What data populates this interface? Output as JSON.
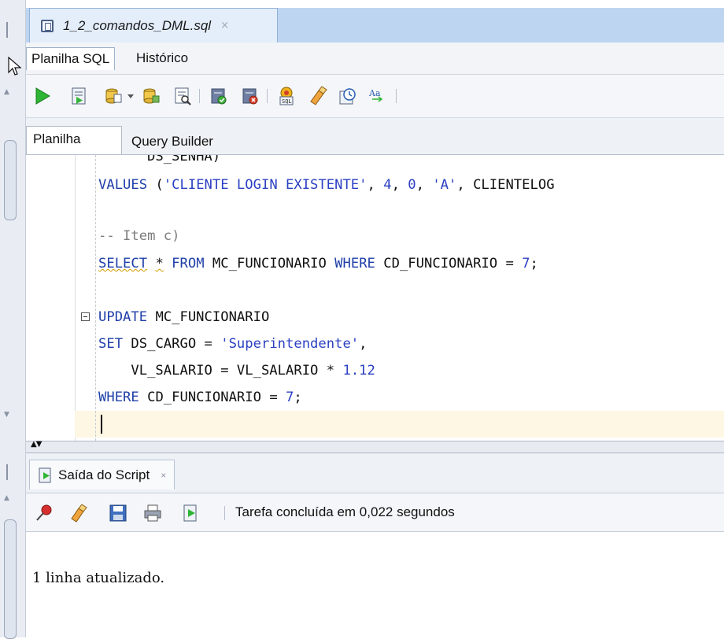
{
  "file_tab": {
    "title": "1_2_comandos_DML.sql",
    "close": "×"
  },
  "sub_tabs": [
    {
      "label": "Planilha SQL"
    },
    {
      "label": "Histórico"
    }
  ],
  "toolbar": {
    "items": [
      "run-statement-icon",
      "run-script-icon",
      "commit-icon",
      "dropdown-arrow-icon",
      "rollback-icon",
      "explain-plan-icon",
      "autotrace-icon",
      "sql-tuning-icon",
      "format-sql-icon",
      "clear-icon",
      "history-icon",
      "uppercase-lowercase-icon"
    ]
  },
  "worksheet_tabs": [
    {
      "label": "Planilha"
    },
    {
      "label": "Query Builder"
    }
  ],
  "editor": {
    "lines": {
      "l0": "DS_SENHA)",
      "l1": "VALUES ('CLIENTE LOGIN EXISTENTE', 4, 0, 'A', 'CLIENTELOG",
      "l2": "",
      "l3": "-- Item c)",
      "l4": "SELECT * FROM MC_FUNCIONARIO WHERE CD_FUNCIONARIO = 7;",
      "l5": "",
      "l6": "UPDATE MC_FUNCIONARIO",
      "l7": "SET DS_CARGO = 'Superintendente',",
      "l8": "    VL_SALARIO = VL_SALARIO * 1.12",
      "l9": "WHERE CD_FUNCIONARIO = 7;"
    }
  },
  "output": {
    "tab_label": "Saída do Script",
    "tab_close": "×",
    "status": "Tarefa concluída em 0,022 segundos",
    "result": "1 linha atualizado."
  },
  "colors": {
    "keyword": "#1f3fa8",
    "string": "#2b40c2",
    "comment": "#7c7c7c",
    "tab_bar": "#bdd5f0"
  }
}
